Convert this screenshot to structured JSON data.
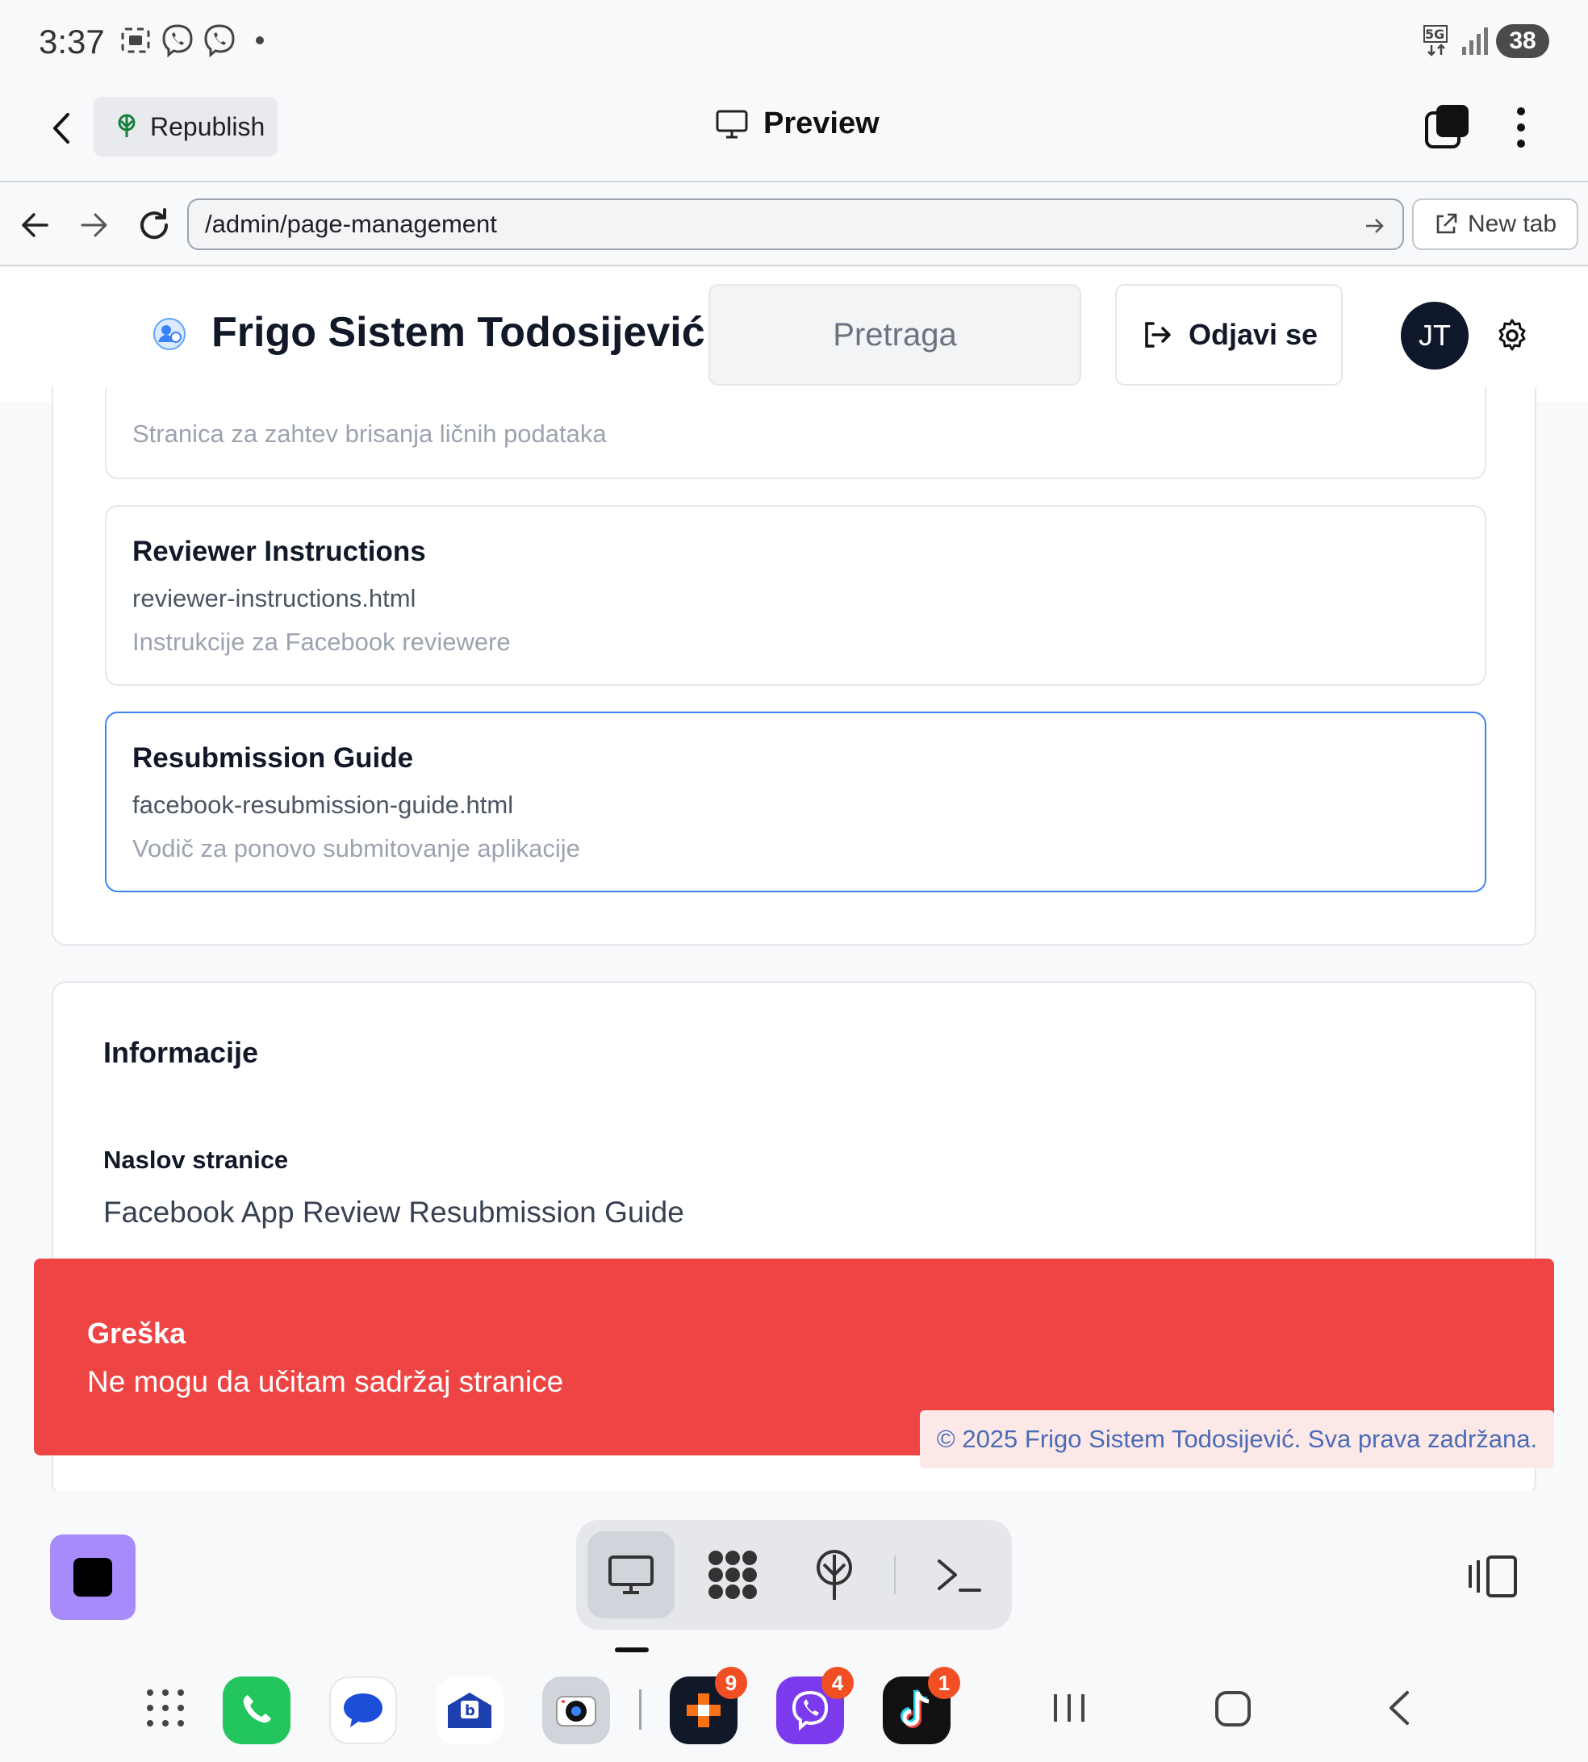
{
  "status_bar": {
    "time": "3:37",
    "battery": "38"
  },
  "toolbar": {
    "republish_label": "Republish",
    "preview_label": "Preview"
  },
  "browser": {
    "url": "/admin/page-management",
    "new_tab_label": "New tab"
  },
  "header": {
    "site_title": "Frigo Sistem Todosijević",
    "search_placeholder": "Pretraga",
    "logout_label": "Odjavi se",
    "avatar_initials": "JT"
  },
  "pages": [
    {
      "title": "",
      "file": "",
      "description": "Stranica za zahtev brisanja ličnih podataka"
    },
    {
      "title": "Reviewer Instructions",
      "file": "reviewer-instructions.html",
      "description": "Instrukcije za Facebook reviewere"
    },
    {
      "title": "Resubmission Guide",
      "file": "facebook-resubmission-guide.html",
      "description": "Vodič za ponovo submitovanje aplikacije"
    }
  ],
  "info": {
    "heading": "Informacije",
    "page_title_label": "Naslov stranice",
    "page_title_value": "Facebook App Review Resubmission Guide"
  },
  "toast": {
    "title": "Greška",
    "message": "Ne mogu da učitam sadržaj stranice"
  },
  "footer": {
    "copyright": "© 2025 Frigo Sistem Todosijević. Sva prava zadržana."
  },
  "dock": {
    "badges": {
      "app1": "9",
      "viber": "4",
      "tiktok": "1"
    }
  },
  "colors": {
    "accent": "#3b82f6",
    "error": "#ef4444",
    "avatar": "#0f172a",
    "stop": "#a78bfa"
  }
}
